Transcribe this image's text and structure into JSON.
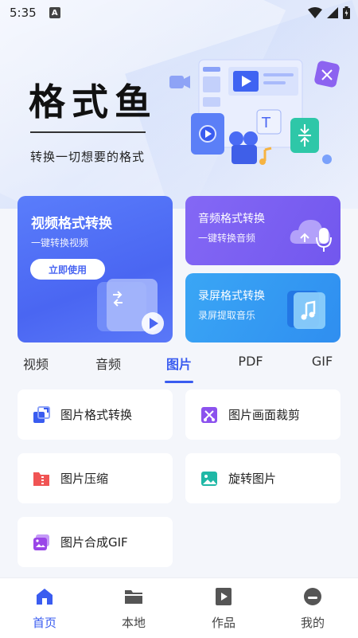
{
  "status_bar": {
    "time": "5:35",
    "badge": "A"
  },
  "hero": {
    "title": "格式鱼",
    "subtitle": "转换一切想要的格式"
  },
  "cards": {
    "video": {
      "title": "视频格式转换",
      "desc": "一键转换视频",
      "button": "立即使用"
    },
    "audio": {
      "title": "音频格式转换",
      "desc": "一键转换音频"
    },
    "record": {
      "title": "录屏格式转换",
      "desc": "录屏提取音乐"
    }
  },
  "tabs": [
    {
      "label": "视频",
      "active": false
    },
    {
      "label": "音频",
      "active": false
    },
    {
      "label": "图片",
      "active": true
    },
    {
      "label": "PDF",
      "active": false
    },
    {
      "label": "GIF",
      "active": false
    }
  ],
  "tools": [
    {
      "label": "图片格式转换",
      "icon": "image-convert-icon"
    },
    {
      "label": "图片画面裁剪",
      "icon": "image-crop-icon"
    },
    {
      "label": "图片压缩",
      "icon": "image-compress-icon"
    },
    {
      "label": "旋转图片",
      "icon": "image-rotate-icon"
    },
    {
      "label": "图片合成GIF",
      "icon": "gif-compose-icon"
    }
  ],
  "nav": [
    {
      "label": "首页",
      "icon": "home-icon",
      "active": true
    },
    {
      "label": "本地",
      "icon": "folder-icon",
      "active": false
    },
    {
      "label": "作品",
      "icon": "play-file-icon",
      "active": false
    },
    {
      "label": "我的",
      "icon": "profile-icon",
      "active": false
    }
  ],
  "colors": {
    "accent": "#3a5cf0",
    "video_card": "#4a66f2",
    "audio_card": "#7257ee",
    "record_card": "#2f8ef0",
    "page_bg": "#f4f6fb"
  }
}
